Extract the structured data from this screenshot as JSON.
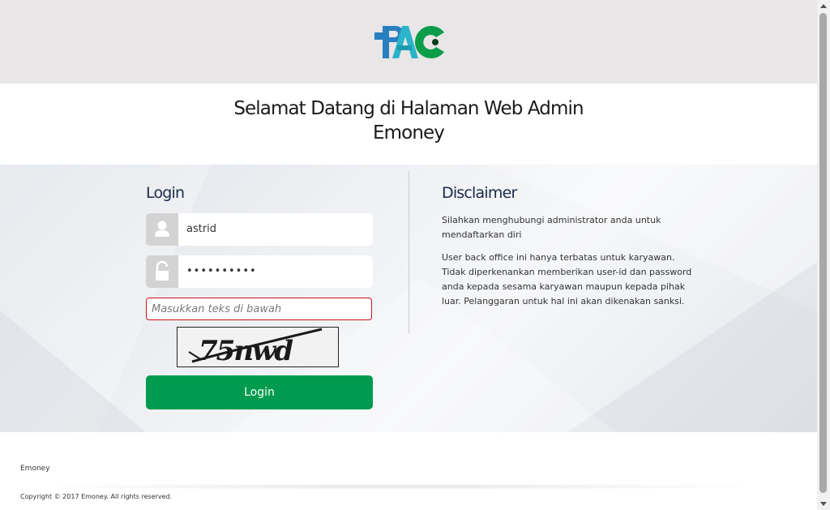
{
  "header": {
    "logo_text": "PAC",
    "colors": {
      "blue": "#2a7fc0",
      "teal": "#2bb3c9",
      "green": "#0c9d4a"
    }
  },
  "welcome": {
    "line1": "Selamat Datang di Halaman Web Admin",
    "line2": "Emoney"
  },
  "login": {
    "title": "Login",
    "username_value": "astrid",
    "password_value": "••••••••••",
    "captcha_placeholder": "Masukkan teks di bawah",
    "captcha_text": "75nwd",
    "button_label": "Login",
    "button_color": "#009b4e"
  },
  "disclaimer": {
    "title": "Disclaimer",
    "p1": "Silahkan menghubungi administrator anda untuk mendaftarkan diri",
    "p2": "User back office ini hanya terbatas untuk karyawan. Tidak diperkenankan memberikan user-id dan password anda kepada sesama karyawan maupun kepada pihak luar. Pelanggaran untuk hal ini akan dikenakan sanksi."
  },
  "footer": {
    "name": "Emoney",
    "copyright": "Copyright © 2017 Emoney. All rights reserved."
  }
}
